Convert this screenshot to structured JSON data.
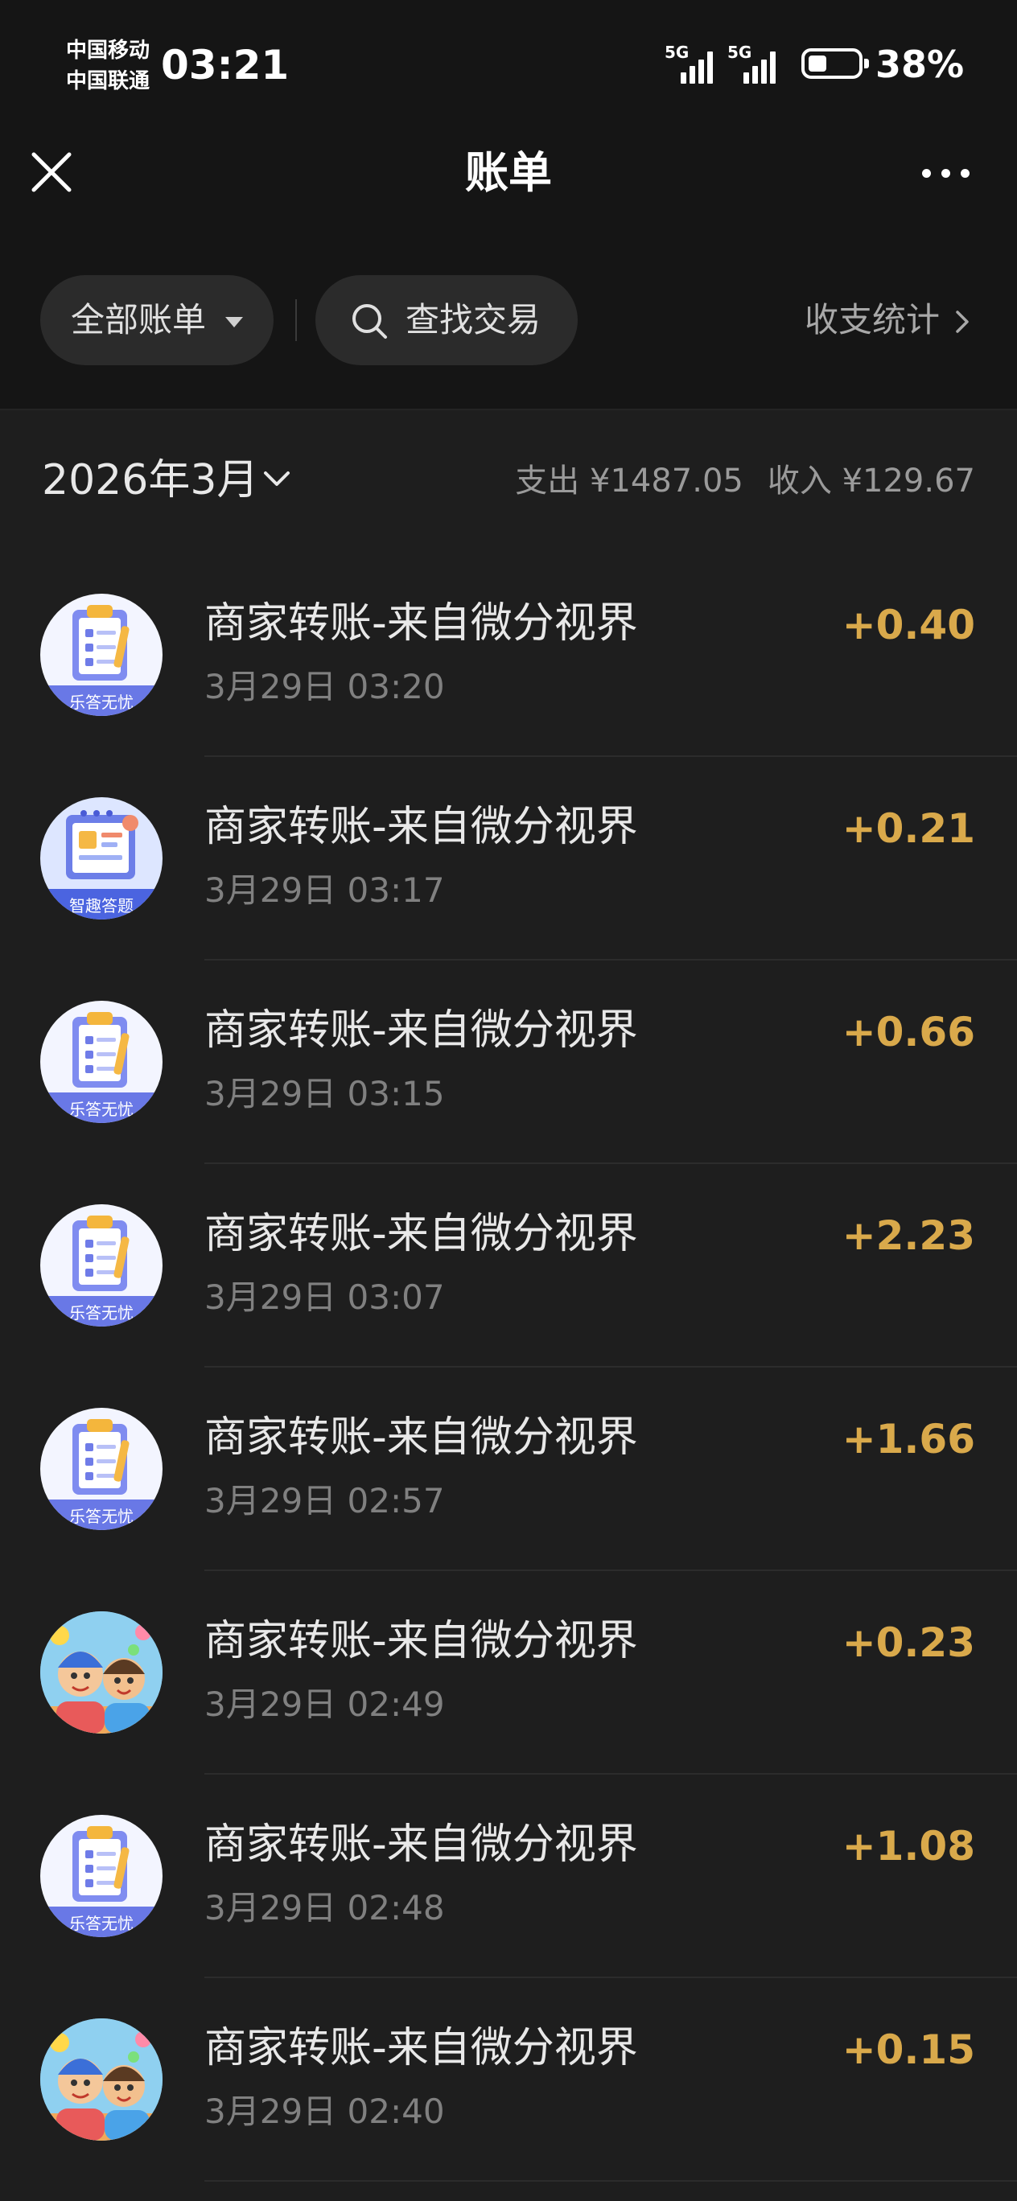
{
  "status_bar": {
    "carrier_1": "中国移动",
    "carrier_2": "中国联通",
    "time": "03:21",
    "signal_1_label": "5G",
    "signal_2_label": "5G",
    "battery_percent": "38%",
    "battery_level": 0.38
  },
  "nav": {
    "title": "账单",
    "close_icon": "close-icon",
    "more_icon": "more-icon"
  },
  "filters": {
    "all_bills": "全部账单",
    "search": "查找交易",
    "stats": "收支统计"
  },
  "month": {
    "label": "2026年3月",
    "expense": "支出 ¥1487.05",
    "income": "收入 ¥129.67"
  },
  "transactions": [
    {
      "title": "商家转账-来自微分视界",
      "time": "3月29日 03:20",
      "amount": "+0.40",
      "avatar": "乐答无忧"
    },
    {
      "title": "商家转账-来自微分视界",
      "time": "3月29日 03:17",
      "amount": "+0.21",
      "avatar": "智趣答题"
    },
    {
      "title": "商家转账-来自微分视界",
      "time": "3月29日 03:15",
      "amount": "+0.66",
      "avatar": "乐答无忧"
    },
    {
      "title": "商家转账-来自微分视界",
      "time": "3月29日 03:07",
      "amount": "+2.23",
      "avatar": "乐答无忧"
    },
    {
      "title": "商家转账-来自微分视界",
      "time": "3月29日 02:57",
      "amount": "+1.66",
      "avatar": "乐答无忧"
    },
    {
      "title": "商家转账-来自微分视界",
      "time": "3月29日 02:49",
      "amount": "+0.23",
      "avatar": ""
    },
    {
      "title": "商家转账-来自微分视界",
      "time": "3月29日 02:48",
      "amount": "+1.08",
      "avatar": "乐答无忧"
    },
    {
      "title": "商家转账-来自微分视界",
      "time": "3月29日 02:40",
      "amount": "+0.15",
      "avatar": ""
    }
  ],
  "colors": {
    "income_amount": "#d9a94b",
    "background": "#1e1e1e",
    "header_background": "#151515"
  }
}
